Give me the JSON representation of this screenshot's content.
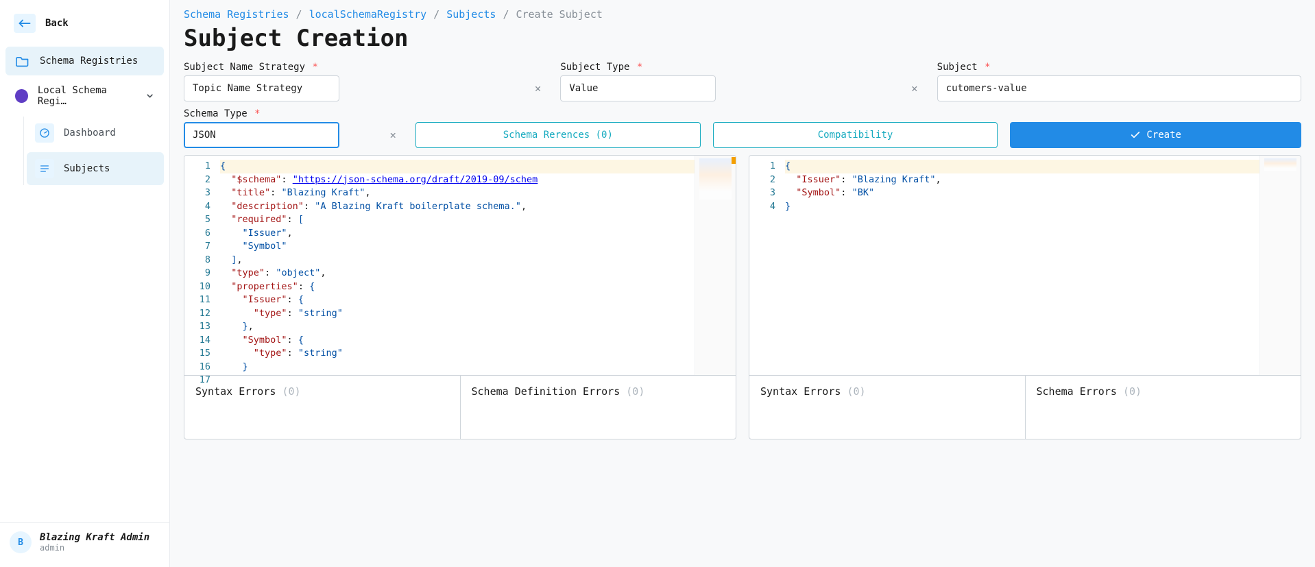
{
  "sidebar": {
    "back_label": "Back",
    "items": [
      {
        "label": "Schema Registries"
      },
      {
        "label": "Local Schema Regi…"
      }
    ],
    "sub_items": [
      {
        "label": "Dashboard"
      },
      {
        "label": "Subjects"
      }
    ]
  },
  "user": {
    "initial": "B",
    "name": "Blazing Kraft Admin",
    "role": "admin"
  },
  "breadcrumbs": {
    "a": "Schema Registries",
    "b": "localSchemaRegistry",
    "c": "Subjects",
    "d": "Create Subject"
  },
  "page": {
    "title": "Subject Creation"
  },
  "form": {
    "name_strategy_label": "Subject Name Strategy",
    "name_strategy_value": "Topic Name Strategy",
    "subject_type_label": "Subject Type",
    "subject_type_value": "Value",
    "subject_label": "Subject",
    "subject_value": "cutomers-value",
    "schema_type_label": "Schema Type",
    "schema_type_value": "JSON",
    "schema_references_label": "Schema Rerences (0)",
    "compatibility_label": "Compatibility",
    "create_label": "Create"
  },
  "editor_left_lines": [
    "{",
    "  \"$schema\": \"https://json-schema.org/draft/2019-09/schem",
    "  \"title\": \"Blazing Kraft\",",
    "  \"description\": \"A Blazing Kraft boilerplate schema.\",",
    "  \"required\": [",
    "    \"Issuer\",",
    "    \"Symbol\"",
    "  ],",
    "  \"type\": \"object\",",
    "  \"properties\": {",
    "    \"Issuer\": {",
    "      \"type\": \"string\"",
    "    },",
    "    \"Symbol\": {",
    "      \"type\": \"string\"",
    "    }",
    "  }"
  ],
  "editor_right_lines": [
    "{",
    "  \"Issuer\": \"Blazing Kraft\",",
    "  \"Symbol\": \"BK\"",
    "}"
  ],
  "errors": {
    "left_a": "Syntax Errors",
    "left_b": "Schema Definition Errors",
    "right_a": "Syntax Errors",
    "right_b": "Schema Errors",
    "count": "(0)"
  }
}
